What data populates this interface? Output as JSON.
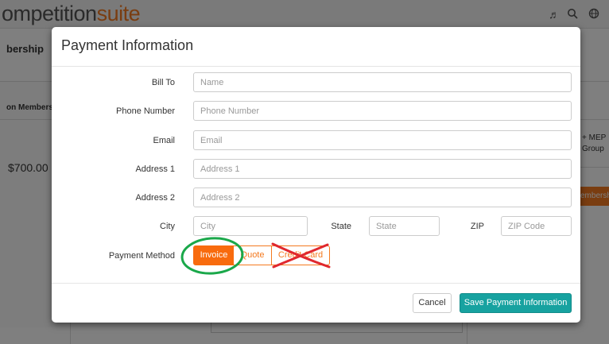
{
  "background": {
    "logo_main": "ompetition",
    "logo_accent": "suite",
    "left_title": "bership",
    "left_tab": "on Membershi",
    "price": "$700.00",
    "right_text_1": "+ MEP",
    "right_text_2": "Group",
    "right_button": "embersh",
    "header_icons": [
      "music-icon",
      "search-icon",
      "globe-icon"
    ]
  },
  "modal": {
    "title": "Payment Information",
    "fields": {
      "bill_to": {
        "label": "Bill To",
        "placeholder": "Name",
        "value": ""
      },
      "phone": {
        "label": "Phone Number",
        "placeholder": "Phone Number",
        "value": ""
      },
      "email": {
        "label": "Email",
        "placeholder": "Email",
        "value": ""
      },
      "address1": {
        "label": "Address 1",
        "placeholder": "Address 1",
        "value": ""
      },
      "address2": {
        "label": "Address 2",
        "placeholder": "Address 2",
        "value": ""
      },
      "city": {
        "label": "City",
        "placeholder": "City",
        "value": ""
      },
      "state": {
        "label": "State",
        "placeholder": "State",
        "value": ""
      },
      "zip": {
        "label": "ZIP",
        "placeholder": "ZIP Code",
        "value": ""
      }
    },
    "payment_method": {
      "label": "Payment Method",
      "options": [
        "Invoice",
        "Quote",
        "Credit Card"
      ],
      "selected": "Invoice"
    },
    "footer": {
      "cancel_label": "Cancel",
      "save_label": "Save Payment Information"
    }
  },
  "colors": {
    "accent_orange": "#f86b0e",
    "save_teal": "#17a2a0",
    "annotation_circle": "#1aa84a",
    "annotation_cross": "#e0282e"
  }
}
